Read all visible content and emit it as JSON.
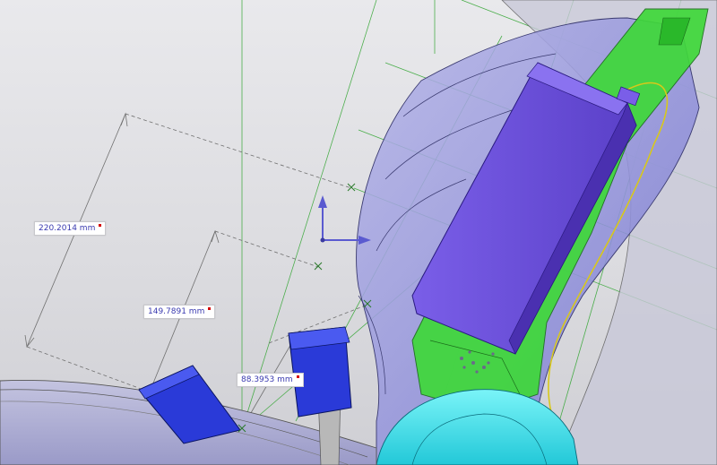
{
  "viewport": {
    "name": "3d-cad-viewport",
    "colors": {
      "background": "#dcdce0",
      "housing": "#8c8cd8",
      "battery": "#6a4ed8",
      "pcb": "#3fd83a",
      "blocks": "#2a3ad8",
      "cyan_part": "#3fe6ee",
      "grid_lines": "#3aa83a",
      "dimension_lines": "#707070",
      "triad": "#5a5ad0"
    }
  },
  "dimensions": [
    {
      "id": "dim-220",
      "value": "220.2014 mm"
    },
    {
      "id": "dim-149",
      "value": "149.7891 mm"
    },
    {
      "id": "dim-88",
      "value": "88.3953 mm"
    }
  ],
  "triad": {
    "icon": "coordinate-triad-icon"
  }
}
